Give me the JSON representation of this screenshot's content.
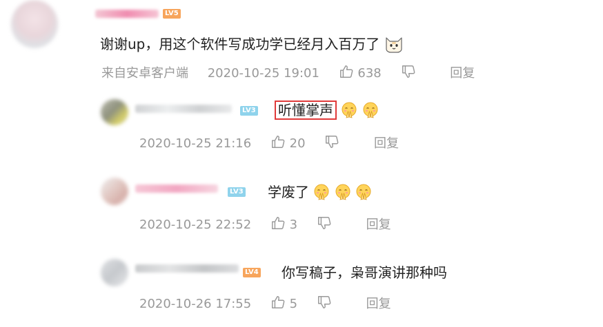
{
  "main_comment": {
    "level_badge": "LV5",
    "text": "谢谢up，用这个软件写成功学已经月入百万了",
    "source": "来自安卓客户端",
    "time": "2020-10-25 19:01",
    "likes": "638",
    "reply_label": "回复"
  },
  "replies": [
    {
      "level_badge": "LV3",
      "text": "听懂掌声",
      "highlighted": true,
      "emoji_count": 2,
      "time": "2020-10-25 21:16",
      "likes": "20",
      "reply_label": "回复"
    },
    {
      "level_badge": "LV3",
      "text": "学废了",
      "highlighted": false,
      "emoji_count": 3,
      "time": "2020-10-25 22:52",
      "likes": "3",
      "reply_label": "回复"
    },
    {
      "level_badge": "LV4",
      "text": "你写稿子，枭哥演讲那种吗",
      "highlighted": false,
      "emoji_count": 0,
      "time": "2020-10-26 17:55",
      "likes": "5",
      "reply_label": "回复"
    }
  ],
  "colors": {
    "highlight_border": "#e03a3a",
    "meta_text": "#999999",
    "lv_orange": "#f7a55c",
    "lv_blue": "#8fd3ec"
  },
  "icons": {
    "like": "thumb-up-icon",
    "dislike": "thumb-down-icon",
    "emoji": "clapping-face-emoji",
    "sticker": "doggie-face-emoji"
  }
}
